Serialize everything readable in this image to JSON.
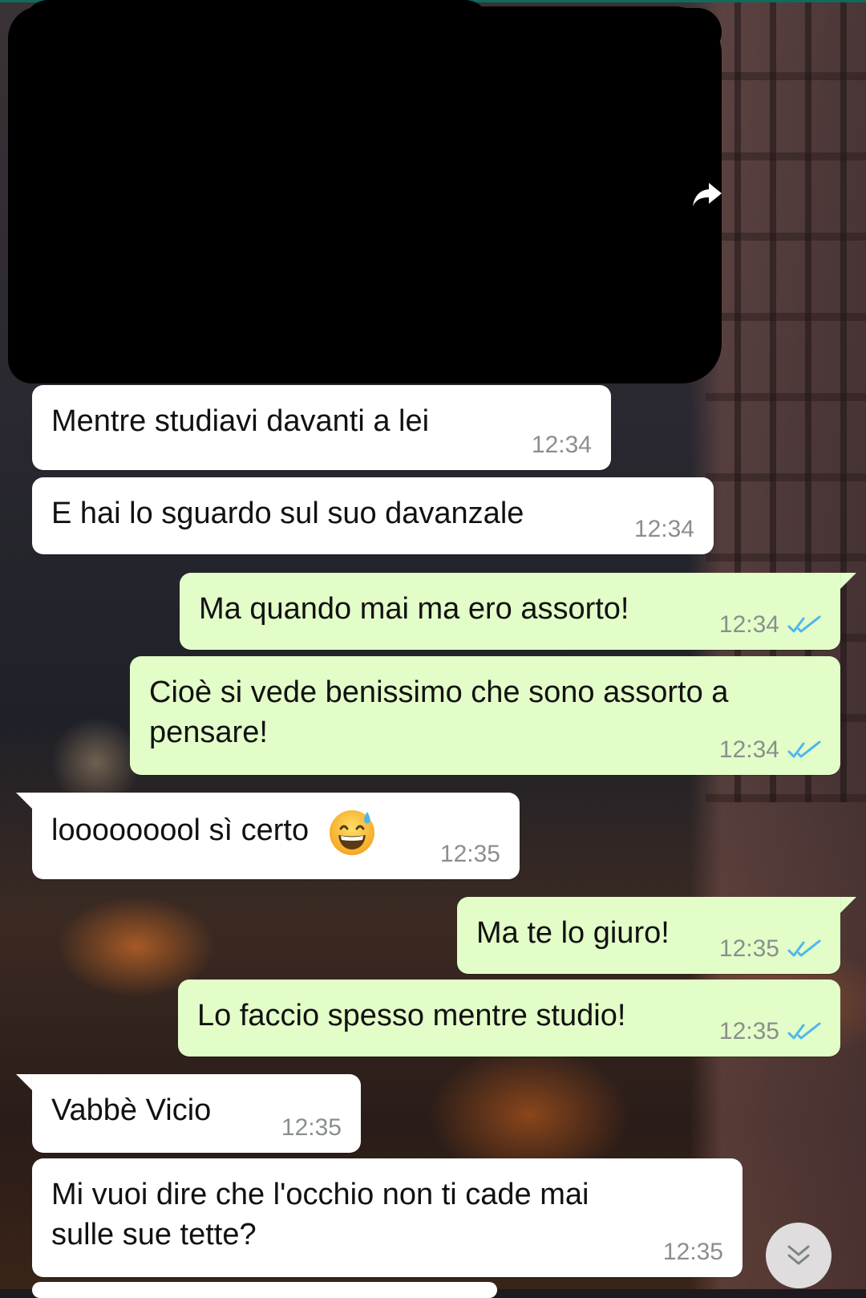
{
  "messages": [
    {
      "id": 1,
      "direction": "in",
      "text": "Mentre studiavi davanti a lei",
      "time": "12:34"
    },
    {
      "id": 2,
      "direction": "in",
      "text": "E hai lo sguardo sul suo davanzale",
      "time": "12:34"
    },
    {
      "id": 3,
      "direction": "out",
      "text": "Ma quando mai ma ero assorto!",
      "time": "12:34",
      "status": "read"
    },
    {
      "id": 4,
      "direction": "out",
      "text_line1": "Cioè si vede benissimo che sono assorto a",
      "text_line2": "pensare!",
      "time": "12:34",
      "status": "read"
    },
    {
      "id": 5,
      "direction": "in",
      "text": "looooooool sì certo",
      "emoji": "grinning-face-with-sweat",
      "time": "12:35"
    },
    {
      "id": 6,
      "direction": "out",
      "text": "Ma te lo giuro!",
      "time": "12:35",
      "status": "read"
    },
    {
      "id": 7,
      "direction": "out",
      "text": "Lo faccio spesso mentre studio!",
      "time": "12:35",
      "status": "read"
    },
    {
      "id": 8,
      "direction": "in",
      "text": "Vabbè Vicio",
      "time": "12:35"
    },
    {
      "id": 9,
      "direction": "in",
      "text_line1": "Mi vuoi dire che l'occhio non ti cade mai",
      "text_line2": "sulle sue tette?",
      "time": "12:35"
    }
  ],
  "icons": {
    "forward": "forward-arrow-icon",
    "read_receipt": "double-check-icon",
    "scroll_down": "chevron-double-down-icon"
  },
  "colors": {
    "incoming_bubble": "#ffffff",
    "outgoing_bubble": "#e2fdc8",
    "read_check": "#4fb6ec",
    "timestamp": "#8a8f8c"
  }
}
